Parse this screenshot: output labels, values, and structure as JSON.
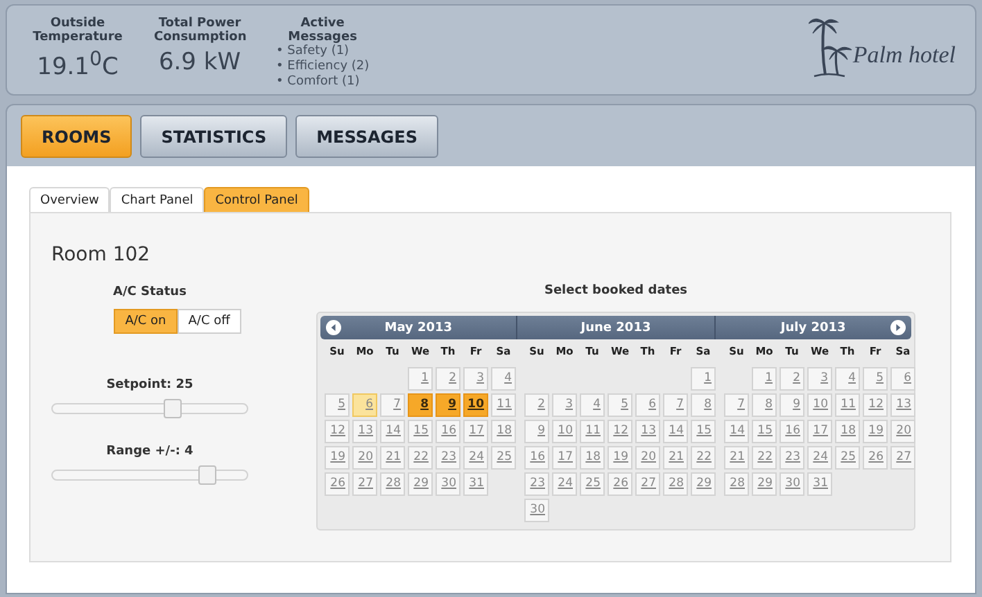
{
  "header": {
    "stats": [
      {
        "label": "Outside Temperature",
        "value": "19.1$^{0}$C"
      },
      {
        "label": "Total Power Consumption",
        "value": "6.9 kW"
      }
    ],
    "messages": {
      "label": "Active Messages",
      "items": [
        "• Safety (1)",
        "• Efficiency (2)",
        "• Comfort (1)"
      ]
    },
    "logo": "Palm hotel"
  },
  "main_tabs": [
    {
      "label": "ROOMS",
      "selected": true
    },
    {
      "label": "STATISTICS",
      "selected": false
    },
    {
      "label": "MESSAGES",
      "selected": false
    }
  ],
  "sub_tabs": [
    {
      "label": "Overview",
      "selected": false
    },
    {
      "label": "Chart Panel",
      "selected": false
    },
    {
      "label": "Control Panel",
      "selected": true
    }
  ],
  "room": {
    "title": "Room 102",
    "ac_label": "A/C Status",
    "ac_buttons": [
      {
        "label": "A/C on",
        "selected": true
      },
      {
        "label": "A/C off",
        "selected": false
      }
    ],
    "sliders": [
      {
        "label": "Setpoint: 25",
        "level": 0.62
      },
      {
        "label": "Range +/-: 4",
        "level": 0.8
      }
    ]
  },
  "calendar": {
    "title": "Select booked dates",
    "months": [
      {
        "title": "May 2013",
        "weekdays": [
          "Su",
          "Mo",
          "Tu",
          "We",
          "Th",
          "Fr",
          "Sa"
        ],
        "weeks": [
          [
            {
              "d": "1",
              "selected": false,
              "today": false
            },
            {
              "d": "2",
              "selected": false,
              "today": false
            },
            {
              "d": "3",
              "selected": false,
              "today": false
            },
            {
              "d": "4",
              "selected": false,
              "today": false
            }
          ],
          [
            {
              "d": "5",
              "selected": false,
              "today": false
            },
            {
              "d": "6",
              "selected": false,
              "today": true
            },
            {
              "d": "7",
              "selected": false,
              "today": false
            },
            {
              "d": "8",
              "selected": true,
              "today": false
            },
            {
              "d": "9",
              "selected": true,
              "today": false
            },
            {
              "d": "10",
              "selected": true,
              "today": false
            },
            {
              "d": "11",
              "selected": false,
              "today": false
            }
          ],
          [
            {
              "d": "12",
              "selected": false,
              "today": false
            },
            {
              "d": "13",
              "selected": false,
              "today": false
            },
            {
              "d": "14",
              "selected": false,
              "today": false
            },
            {
              "d": "15",
              "selected": false,
              "today": false
            },
            {
              "d": "16",
              "selected": false,
              "today": false
            },
            {
              "d": "17",
              "selected": false,
              "today": false
            },
            {
              "d": "18",
              "selected": false,
              "today": false
            }
          ],
          [
            {
              "d": "19",
              "selected": false,
              "today": false
            },
            {
              "d": "20",
              "selected": false,
              "today": false
            },
            {
              "d": "21",
              "selected": false,
              "today": false
            },
            {
              "d": "22",
              "selected": false,
              "today": false
            },
            {
              "d": "23",
              "selected": false,
              "today": false
            },
            {
              "d": "24",
              "selected": false,
              "today": false
            },
            {
              "d": "25",
              "selected": false,
              "today": false
            }
          ],
          [
            {
              "d": "26",
              "selected": false,
              "today": false
            },
            {
              "d": "27",
              "selected": false,
              "today": false
            },
            {
              "d": "28",
              "selected": false,
              "today": false
            },
            {
              "d": "29",
              "selected": false,
              "today": false
            },
            {
              "d": "30",
              "selected": false,
              "today": false
            },
            {
              "d": "31",
              "selected": false,
              "today": false
            }
          ]
        ]
      },
      {
        "title": "June 2013",
        "weekdays": [
          "Su",
          "Mo",
          "Tu",
          "We",
          "Th",
          "Fr",
          "Sa"
        ],
        "weeks": [
          [
            {
              "d": "1",
              "selected": false,
              "today": false
            }
          ],
          [
            {
              "d": "2",
              "selected": false,
              "today": false
            },
            {
              "d": "3",
              "selected": false,
              "today": false
            },
            {
              "d": "4",
              "selected": false,
              "today": false
            },
            {
              "d": "5",
              "selected": false,
              "today": false
            },
            {
              "d": "6",
              "selected": false,
              "today": false
            },
            {
              "d": "7",
              "selected": false,
              "today": false
            },
            {
              "d": "8",
              "selected": false,
              "today": false
            }
          ],
          [
            {
              "d": "9",
              "selected": false,
              "today": false
            },
            {
              "d": "10",
              "selected": false,
              "today": false
            },
            {
              "d": "11",
              "selected": false,
              "today": false
            },
            {
              "d": "12",
              "selected": false,
              "today": false
            },
            {
              "d": "13",
              "selected": false,
              "today": false
            },
            {
              "d": "14",
              "selected": false,
              "today": false
            },
            {
              "d": "15",
              "selected": false,
              "today": false
            }
          ],
          [
            {
              "d": "16",
              "selected": false,
              "today": false
            },
            {
              "d": "17",
              "selected": false,
              "today": false
            },
            {
              "d": "18",
              "selected": false,
              "today": false
            },
            {
              "d": "19",
              "selected": false,
              "today": false
            },
            {
              "d": "20",
              "selected": false,
              "today": false
            },
            {
              "d": "21",
              "selected": false,
              "today": false
            },
            {
              "d": "22",
              "selected": false,
              "today": false
            }
          ],
          [
            {
              "d": "23",
              "selected": false,
              "today": false
            },
            {
              "d": "24",
              "selected": false,
              "today": false
            },
            {
              "d": "25",
              "selected": false,
              "today": false
            },
            {
              "d": "26",
              "selected": false,
              "today": false
            },
            {
              "d": "27",
              "selected": false,
              "today": false
            },
            {
              "d": "28",
              "selected": false,
              "today": false
            },
            {
              "d": "29",
              "selected": false,
              "today": false
            }
          ],
          [
            {
              "d": "30",
              "selected": false,
              "today": false
            }
          ]
        ]
      },
      {
        "title": "July 2013",
        "weekdays": [
          "Su",
          "Mo",
          "Tu",
          "We",
          "Th",
          "Fr",
          "Sa"
        ],
        "weeks": [
          [
            {
              "d": "1",
              "selected": false,
              "today": false
            },
            {
              "d": "2",
              "selected": false,
              "today": false
            },
            {
              "d": "3",
              "selected": false,
              "today": false
            },
            {
              "d": "4",
              "selected": false,
              "today": false
            },
            {
              "d": "5",
              "selected": false,
              "today": false
            },
            {
              "d": "6",
              "selected": false,
              "today": false
            }
          ],
          [
            {
              "d": "7",
              "selected": false,
              "today": false
            },
            {
              "d": "8",
              "selected": false,
              "today": false
            },
            {
              "d": "9",
              "selected": false,
              "today": false
            },
            {
              "d": "10",
              "selected": false,
              "today": false
            },
            {
              "d": "11",
              "selected": false,
              "today": false
            },
            {
              "d": "12",
              "selected": false,
              "today": false
            },
            {
              "d": "13",
              "selected": false,
              "today": false
            }
          ],
          [
            {
              "d": "14",
              "selected": false,
              "today": false
            },
            {
              "d": "15",
              "selected": false,
              "today": false
            },
            {
              "d": "16",
              "selected": false,
              "today": false
            },
            {
              "d": "17",
              "selected": false,
              "today": false
            },
            {
              "d": "18",
              "selected": false,
              "today": false
            },
            {
              "d": "19",
              "selected": false,
              "today": false
            },
            {
              "d": "20",
              "selected": false,
              "today": false
            }
          ],
          [
            {
              "d": "21",
              "selected": false,
              "today": false
            },
            {
              "d": "22",
              "selected": false,
              "today": false
            },
            {
              "d": "23",
              "selected": false,
              "today": false
            },
            {
              "d": "24",
              "selected": false,
              "today": false
            },
            {
              "d": "25",
              "selected": false,
              "today": false
            },
            {
              "d": "26",
              "selected": false,
              "today": false
            },
            {
              "d": "27",
              "selected": false,
              "today": false
            }
          ],
          [
            {
              "d": "28",
              "selected": false,
              "today": false
            },
            {
              "d": "29",
              "selected": false,
              "today": false
            },
            {
              "d": "30",
              "selected": false,
              "today": false
            },
            {
              "d": "31",
              "selected": false,
              "today": false
            }
          ]
        ]
      }
    ]
  }
}
